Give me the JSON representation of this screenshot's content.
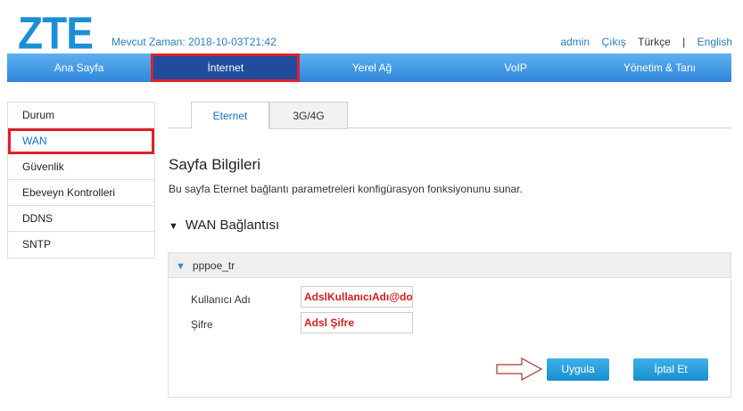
{
  "header": {
    "logo": "ZTE",
    "current_time": "Mevcut Zaman: 2018-10-03T21:42",
    "user": "admin",
    "logout": "Çıkış",
    "lang_tr": "Türkçe",
    "separator": "|",
    "lang_en": "English"
  },
  "nav": [
    "Ana Sayfa",
    "İnternet",
    "Yerel Ağ",
    "VoIP",
    "Yönetim & Tanı"
  ],
  "sidebar": [
    "Durum",
    "WAN",
    "Güvenlik",
    "Ebeveyn Kontrolleri",
    "DDNS",
    "SNTP"
  ],
  "tabs": [
    "Eternet",
    "3G/4G"
  ],
  "page": {
    "title": "Sayfa Bilgileri",
    "description": "Bu sayfa Eternet bağlantı parametreleri konfigürasyon fonksiyonunu sunar.",
    "section": "WAN Bağlantısı"
  },
  "connection": {
    "name": "pppoe_tr",
    "username_label": "Kullanıcı Adı",
    "username_value": "AdslKullanıcıAdı@domain",
    "password_label": "Şifre",
    "password_value": "Adsl Şifre",
    "apply": "Uygula",
    "cancel": "İptal Et"
  }
}
